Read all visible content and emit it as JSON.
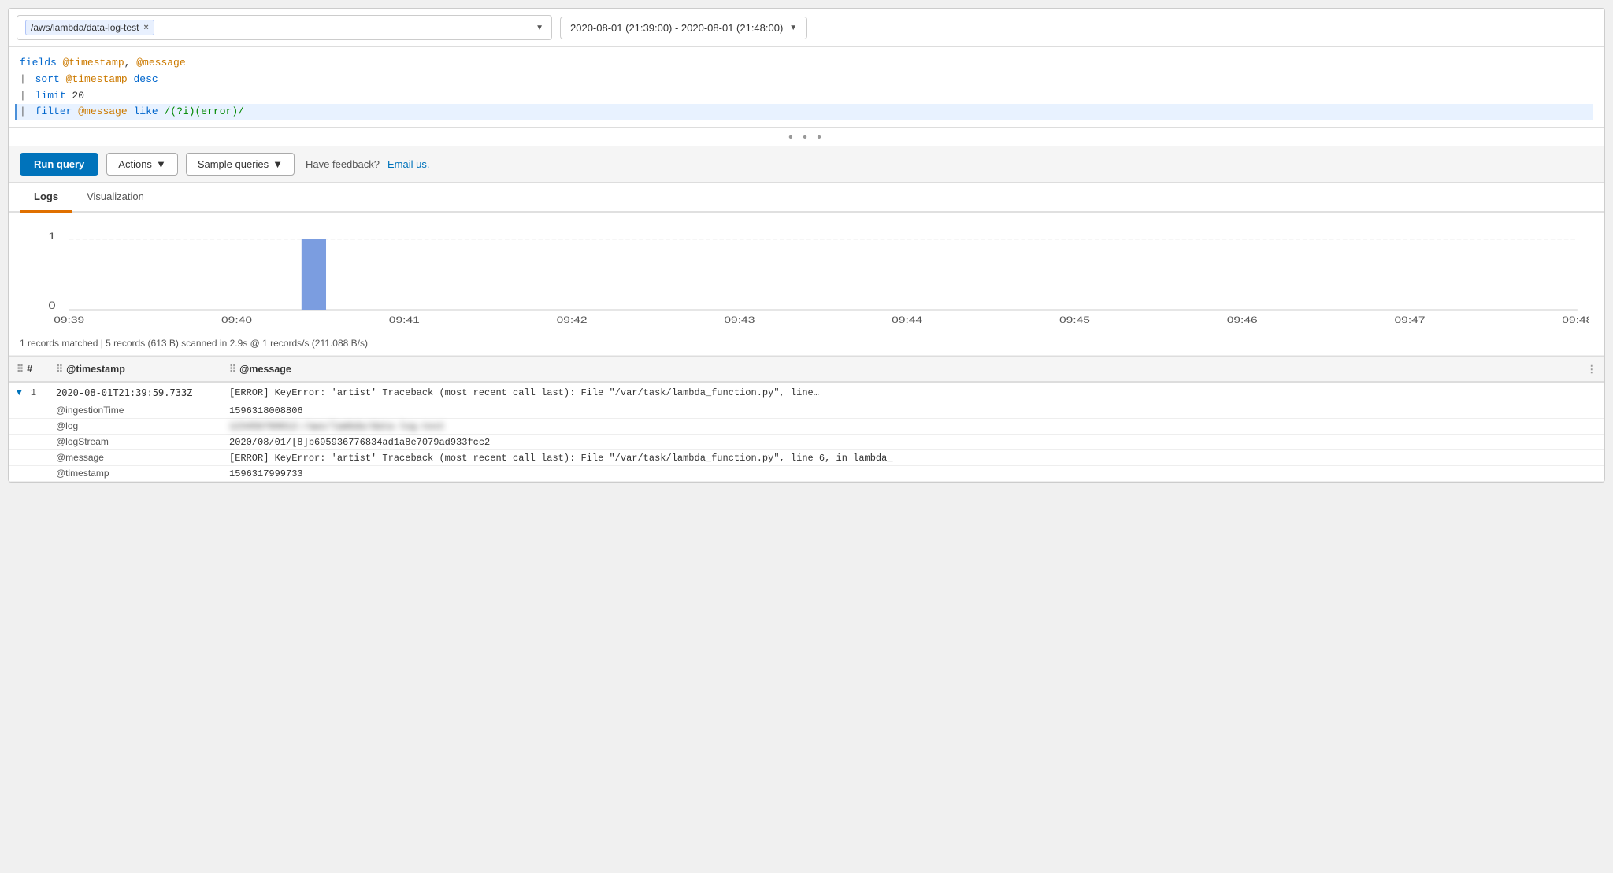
{
  "topbar": {
    "logGroup": {
      "name": "/aws/lambda/data-log-test",
      "closeLabel": "×"
    },
    "dateRange": "2020-08-01 (21:39:00) - 2020-08-01 (21:48:00)"
  },
  "query": {
    "lines": [
      {
        "type": "plain",
        "text": "fields @timestamp, @message"
      },
      {
        "type": "pipe",
        "pipe": "|",
        "keyword": "sort",
        "rest": " @timestamp ",
        "keyword2": "desc",
        "rest2": ""
      },
      {
        "type": "pipe",
        "pipe": "|",
        "keyword": "limit",
        "rest": " 20",
        "keyword2": "",
        "rest2": ""
      },
      {
        "type": "pipe-cursor",
        "pipe": "|",
        "keyword": "filter",
        "rest": " @message ",
        "keyword2": "like",
        "rest2": " ",
        "regex": "/(?i)(error)/",
        "cursor": true
      }
    ]
  },
  "toolbar": {
    "runQueryLabel": "Run query",
    "actionsLabel": "Actions",
    "sampleQueriesLabel": "Sample queries",
    "feedbackLabel": "Have feedback?",
    "emailLabel": "Email us."
  },
  "tabs": [
    {
      "id": "logs",
      "label": "Logs",
      "active": true
    },
    {
      "id": "visualization",
      "label": "Visualization",
      "active": false
    }
  ],
  "chart": {
    "yMax": 1,
    "yMin": 0,
    "xLabels": [
      "09:39",
      "09:40",
      "09:41",
      "09:42",
      "09:43",
      "09:44",
      "09:45",
      "09:46",
      "09:47",
      "09:48"
    ],
    "barData": [
      {
        "time": "09:40",
        "value": 1
      }
    ],
    "barColor": "#7b9de0"
  },
  "stats": "1 records matched | 5 records (613 B) scanned in 2.9s @ 1 records/s (211.088 B/s)",
  "tableColumns": [
    {
      "id": "hash",
      "label": "#"
    },
    {
      "id": "timestamp",
      "label": "@timestamp"
    },
    {
      "id": "message",
      "label": "@message"
    }
  ],
  "results": [
    {
      "rowNum": "1",
      "timestamp": "2020-08-01T21:39:59.733Z",
      "message": "[ERROR] KeyError: 'artist' Traceback (most recent call last):    File \"/var/task/lambda_function.py\", line…",
      "details": [
        {
          "label": "@ingestionTime",
          "value": "1596318008806",
          "blurred": false
        },
        {
          "label": "@log",
          "value": "123456789012:/aws/lambda/data-log-test",
          "blurred": true
        },
        {
          "label": "@logStream",
          "value": "2020/08/01/[8]b695936776834ad1a8e7079ad933fcc2",
          "blurred": false
        },
        {
          "label": "@message",
          "value": "[ERROR] KeyError: 'artist' Traceback (most recent call last):    File \"/var/task/lambda_function.py\", line 6, in lambda_",
          "blurred": false
        },
        {
          "label": "@timestamp",
          "value": "1596317999733",
          "blurred": false
        }
      ]
    }
  ]
}
